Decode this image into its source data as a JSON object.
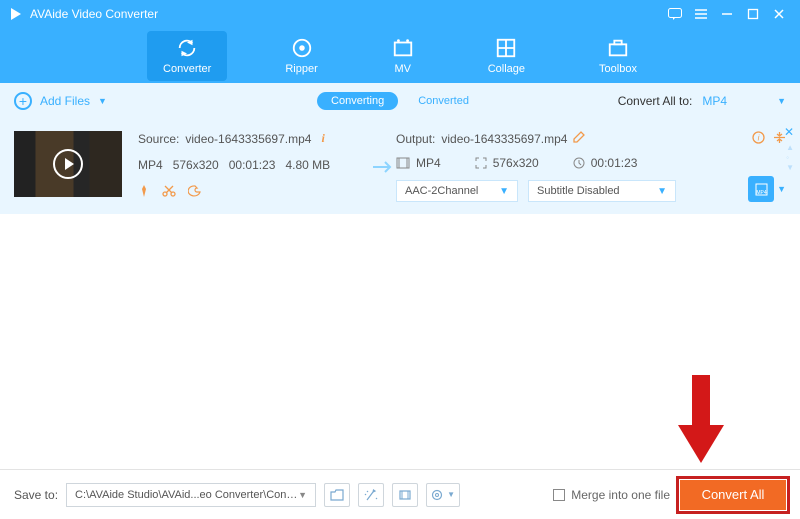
{
  "app": {
    "title": "AVAide Video Converter"
  },
  "nav": {
    "items": [
      {
        "label": "Converter"
      },
      {
        "label": "Ripper"
      },
      {
        "label": "MV"
      },
      {
        "label": "Collage"
      },
      {
        "label": "Toolbox"
      }
    ]
  },
  "toolbar": {
    "add_files": "Add Files",
    "tab_converting": "Converting",
    "tab_converted": "Converted",
    "convert_all_to_label": "Convert All to:",
    "convert_all_to_value": "MP4"
  },
  "item": {
    "source_prefix": "Source:",
    "source_name": "video-1643335697.mp4",
    "format": "MP4",
    "resolution": "576x320",
    "duration": "00:01:23",
    "size": "4.80 MB",
    "output_prefix": "Output:",
    "output_name": "video-1643335697.mp4",
    "output_format": "MP4",
    "output_resolution": "576x320",
    "output_duration": "00:01:23",
    "audio_dd": "AAC-2Channel",
    "subtitle_dd": "Subtitle Disabled"
  },
  "bottom": {
    "save_to_label": "Save to:",
    "save_path": "C:\\AVAide Studio\\AVAid...eo Converter\\Converted",
    "merge_label": "Merge into one file",
    "convert_all_btn": "Convert All"
  }
}
